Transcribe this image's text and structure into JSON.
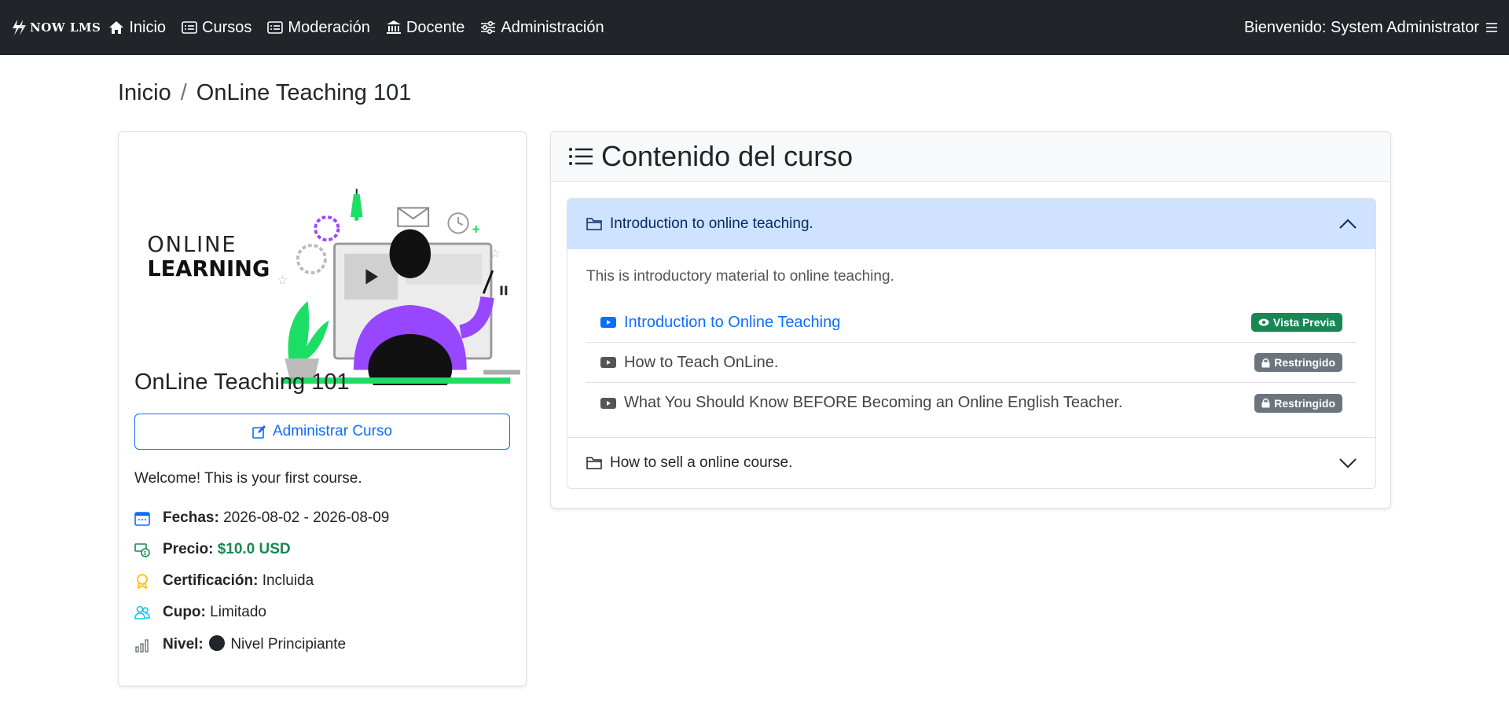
{
  "nav": {
    "brand": "NOW LMS",
    "items": [
      {
        "label": "Inicio",
        "icon": "home-icon"
      },
      {
        "label": "Cursos",
        "icon": "card-list-icon"
      },
      {
        "label": "Moderación",
        "icon": "card-list-icon"
      },
      {
        "label": "Docente",
        "icon": "bank-icon"
      },
      {
        "label": "Administración",
        "icon": "sliders-icon"
      }
    ],
    "welcome": "Bienvenido: System Administrator"
  },
  "breadcrumb": {
    "home": "Inicio",
    "separator": "/",
    "current": "OnLine Teaching 101"
  },
  "course": {
    "image_text_line1": "ONLINE",
    "image_text_line2": "LEARNING",
    "title": "OnLine Teaching 101",
    "manage_label": "Administrar Curso",
    "description": "Welcome! This is your first course.",
    "info": {
      "dates_label": "Fechas:",
      "dates_value": "2026-08-02 - 2026-08-09",
      "price_label": "Precio:",
      "price_value": "$10.0 USD",
      "cert_label": "Certificación:",
      "cert_value": "Incluida",
      "seats_label": "Cupo:",
      "seats_value": "Limitado",
      "level_label": "Nivel:",
      "level_value": "Nivel Principiante"
    }
  },
  "content": {
    "title": "Contenido del curso",
    "sections": [
      {
        "title": "Introduction to online teaching.",
        "description": "This is introductory material to online teaching.",
        "lessons": [
          {
            "title": "Introduction to Online Teaching",
            "badge": "Vista Previa"
          },
          {
            "title": "How to Teach OnLine.",
            "badge": "Restringido"
          },
          {
            "title": "What You Should Know BEFORE Becoming an Online English Teacher.",
            "badge": "Restringido"
          }
        ]
      },
      {
        "title": "How to sell a online course."
      }
    ]
  },
  "colors": {
    "navbar": "#212529",
    "primary": "#0d6efd",
    "success": "#198754",
    "secondary": "#6c757d",
    "accordion_active": "#cfe2ff",
    "illustration_purple": "#9747ff",
    "illustration_green": "#1dde65"
  }
}
